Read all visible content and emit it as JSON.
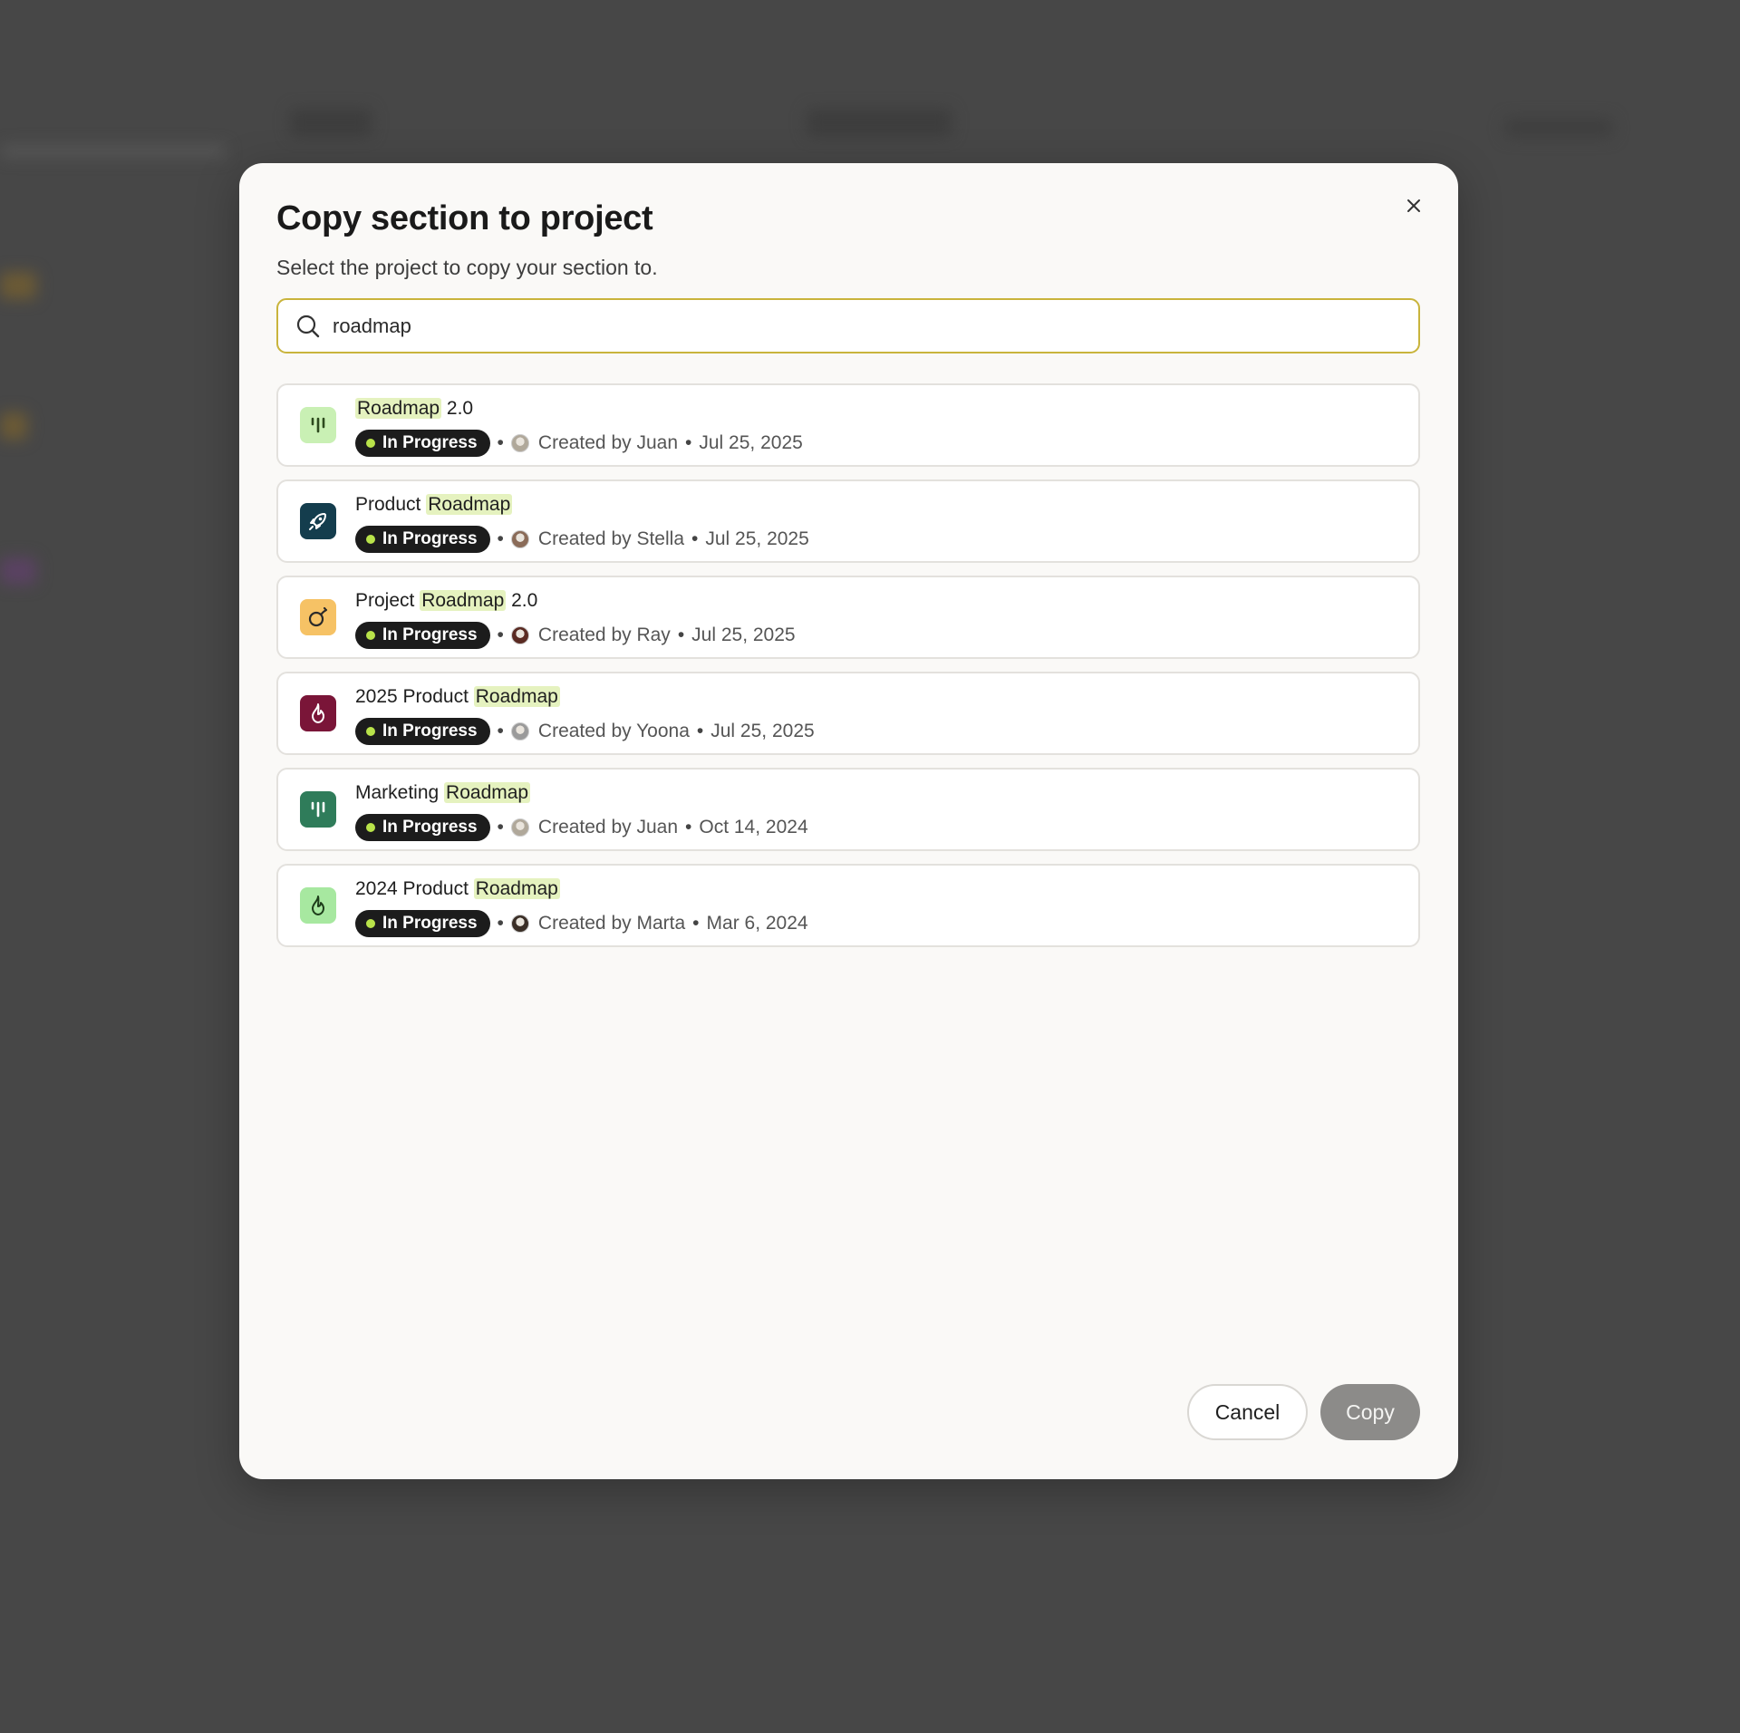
{
  "dialog": {
    "title": "Copy section to project",
    "subtitle": "Select the project to copy your section to.",
    "search": {
      "value": "roadmap",
      "placeholder": ""
    },
    "status_color": "#b9e34a",
    "highlight_color": "#e5f2bf",
    "projects": [
      {
        "name_before": "",
        "name_match": "Roadmap",
        "name_after": " 2.0",
        "status": "In Progress",
        "created_by": "Created by Juan",
        "date": "Jul 25, 2025",
        "icon": "bars-icon",
        "icon_bg": "#c9f0b4",
        "icon_fg": "#2d4a1e",
        "avatar": "#b0a89a"
      },
      {
        "name_before": "Product ",
        "name_match": "Roadmap",
        "name_after": "",
        "status": "In Progress",
        "created_by": "Created by Stella",
        "date": "Jul 25, 2025",
        "icon": "rocket-icon",
        "icon_bg": "#143d4d",
        "icon_fg": "#ffffff",
        "avatar": "#8a6b58"
      },
      {
        "name_before": "Project ",
        "name_match": "Roadmap",
        "name_after": " 2.0",
        "status": "In Progress",
        "created_by": "Created by Ray",
        "date": "Jul 25, 2025",
        "icon": "bomb-icon",
        "icon_bg": "#f6c265",
        "icon_fg": "#2a2a2a",
        "avatar": "#5a2a22"
      },
      {
        "name_before": "2025 Product ",
        "name_match": "Roadmap",
        "name_after": "",
        "status": "In Progress",
        "created_by": "Created by Yoona",
        "date": "Jul 25, 2025",
        "icon": "flame-icon",
        "icon_bg": "#7a1538",
        "icon_fg": "#ffffff",
        "avatar": "#9a9a9a"
      },
      {
        "name_before": "Marketing ",
        "name_match": "Roadmap",
        "name_after": "",
        "status": "In Progress",
        "created_by": "Created by Juan",
        "date": "Oct 14, 2024",
        "icon": "bars-icon",
        "icon_bg": "#2f7c5a",
        "icon_fg": "#ffffff",
        "avatar": "#b0a89a"
      },
      {
        "name_before": "2024 Product ",
        "name_match": "Roadmap",
        "name_after": "",
        "status": "In Progress",
        "created_by": "Created by Marta",
        "date": "Mar 6, 2024",
        "icon": "flame-icon",
        "icon_bg": "#a7e8a0",
        "icon_fg": "#1d3d1a",
        "avatar": "#3a2e26"
      }
    ],
    "cancel_label": "Cancel",
    "copy_label": "Copy"
  }
}
